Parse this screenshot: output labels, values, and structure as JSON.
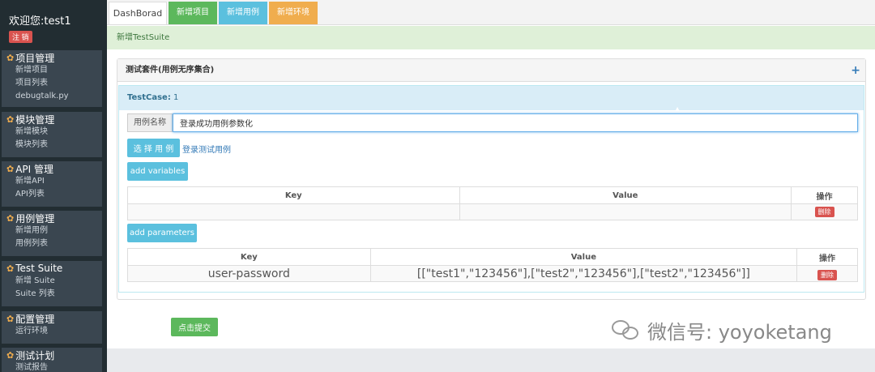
{
  "sidebar": {
    "welcome": "欢迎您:test1",
    "logout": "注 销",
    "groups": [
      {
        "title": "项目管理",
        "items": [
          "新增项目",
          "项目列表",
          "debugtalk.py"
        ]
      },
      {
        "title": "模块管理",
        "items": [
          "新增模块",
          "模块列表"
        ]
      },
      {
        "title": "API 管理",
        "items": [
          "新增API",
          "API列表"
        ]
      },
      {
        "title": "用例管理",
        "items": [
          "新增用例",
          "用例列表"
        ]
      },
      {
        "title": "Test Suite",
        "items": [
          "新增 Suite",
          "Suite 列表"
        ]
      },
      {
        "title": "配置管理",
        "items": [
          "运行环境"
        ]
      },
      {
        "title": "测试计划",
        "items": [
          "测试报告"
        ]
      }
    ]
  },
  "tabs": [
    "DashBorad",
    "新增项目",
    "新增用例",
    "新增环境"
  ],
  "alert": "新增TestSuite",
  "panel": {
    "title": "测试套件(用例无序集合)",
    "plus": "+"
  },
  "testcase": {
    "label": "TestCase:",
    "index": "1",
    "name_addon": "用例名称",
    "name_value": "登录成功用例参数化",
    "select_button": "选 择 用 例",
    "selected_case": "登录测试用例",
    "add_variables": "add variables",
    "add_parameters": "add parameters"
  },
  "variables_table": {
    "headers": [
      "Key",
      "Value",
      "操作"
    ],
    "delete": "删除"
  },
  "parameters_table": {
    "headers": [
      "Key",
      "Value",
      "操作"
    ],
    "row": {
      "key": "user-password",
      "value": "[[\"test1\",\"123456\"],[\"test2\",\"123456\"],[\"test2\",\"123456\"]]"
    },
    "delete": "删除"
  },
  "submit": "点击提交",
  "watermark": "微信号: yoyoketang",
  "colors": {
    "sidebar": "#222d32",
    "success": "#5cb85c",
    "info": "#5bc0de",
    "warning": "#f0ad4e",
    "danger": "#d9534f"
  }
}
